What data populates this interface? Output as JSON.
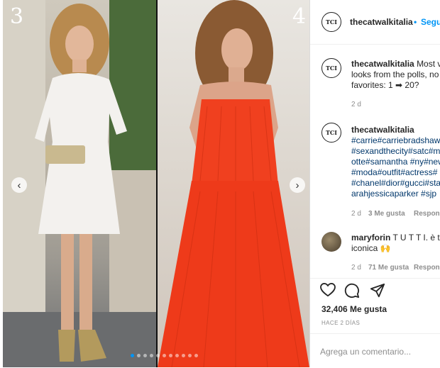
{
  "post": {
    "panel_left_number": "3",
    "panel_right_number": "4",
    "carousel_dot_count": 11,
    "carousel_active_index": 0
  },
  "header": {
    "avatar_text": "TCI",
    "username": "thecatwalkitalia",
    "separator": "•",
    "follow_label": "Segui"
  },
  "comments": [
    {
      "avatar_text": "TCI",
      "username": "thecatwalkitalia",
      "lines": [
        "Most v",
        "looks from the polls, no",
        "favorites: 1 ➡ 20?"
      ],
      "time": "2 d"
    },
    {
      "avatar_text": "TCI",
      "username": "thecatwalkitalia",
      "lines": [
        "#carrie#carriebradshaw",
        "#sexandthecity#satc#m",
        "otte#samantha #ny#new",
        "#moda#outfit#actress#",
        "#chanel#dior#gucci#sta",
        "arahjessicaparker #sjp"
      ],
      "time": "2 d",
      "likes": "3 Me gusta",
      "reply": "Responder"
    },
    {
      "username": "maryforin",
      "text1": "T U T T I. è ta",
      "text2": "iconica 🙌",
      "time": "2 d",
      "likes": "71 Me gusta",
      "reply": "Responder"
    }
  ],
  "footer": {
    "likes_count": "32,406 Me gusta",
    "posted_time": "HACE 2 DÍAS",
    "comment_placeholder": "Agrega un comentario..."
  }
}
